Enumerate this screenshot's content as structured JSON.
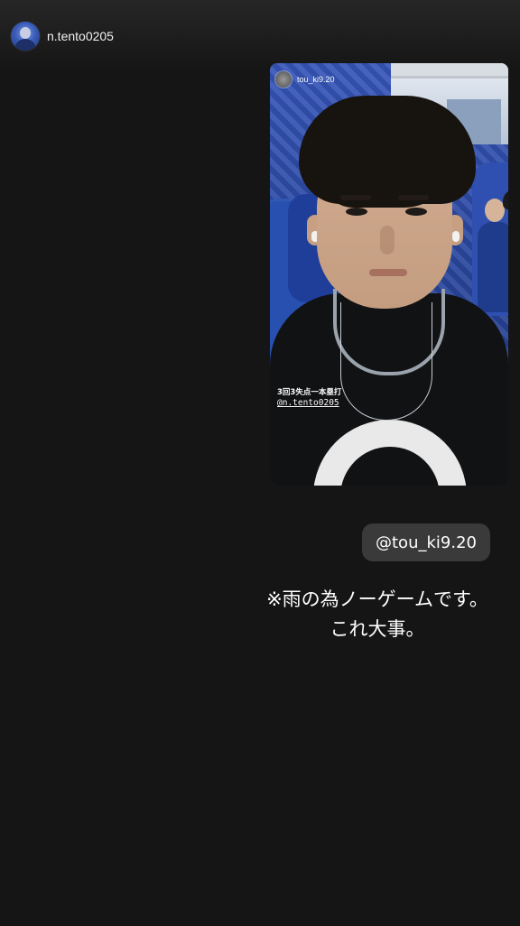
{
  "header": {
    "username": "n.tento0205"
  },
  "story_card": {
    "username": "tou_ki9.20",
    "caption": "3回3失点一本塁打",
    "mention": "@n.tento0205"
  },
  "mention_chip": {
    "label": "@tou_ki9.20"
  },
  "message": {
    "line1": "※雨の為ノーゲームです。",
    "line2": "これ大事。"
  }
}
